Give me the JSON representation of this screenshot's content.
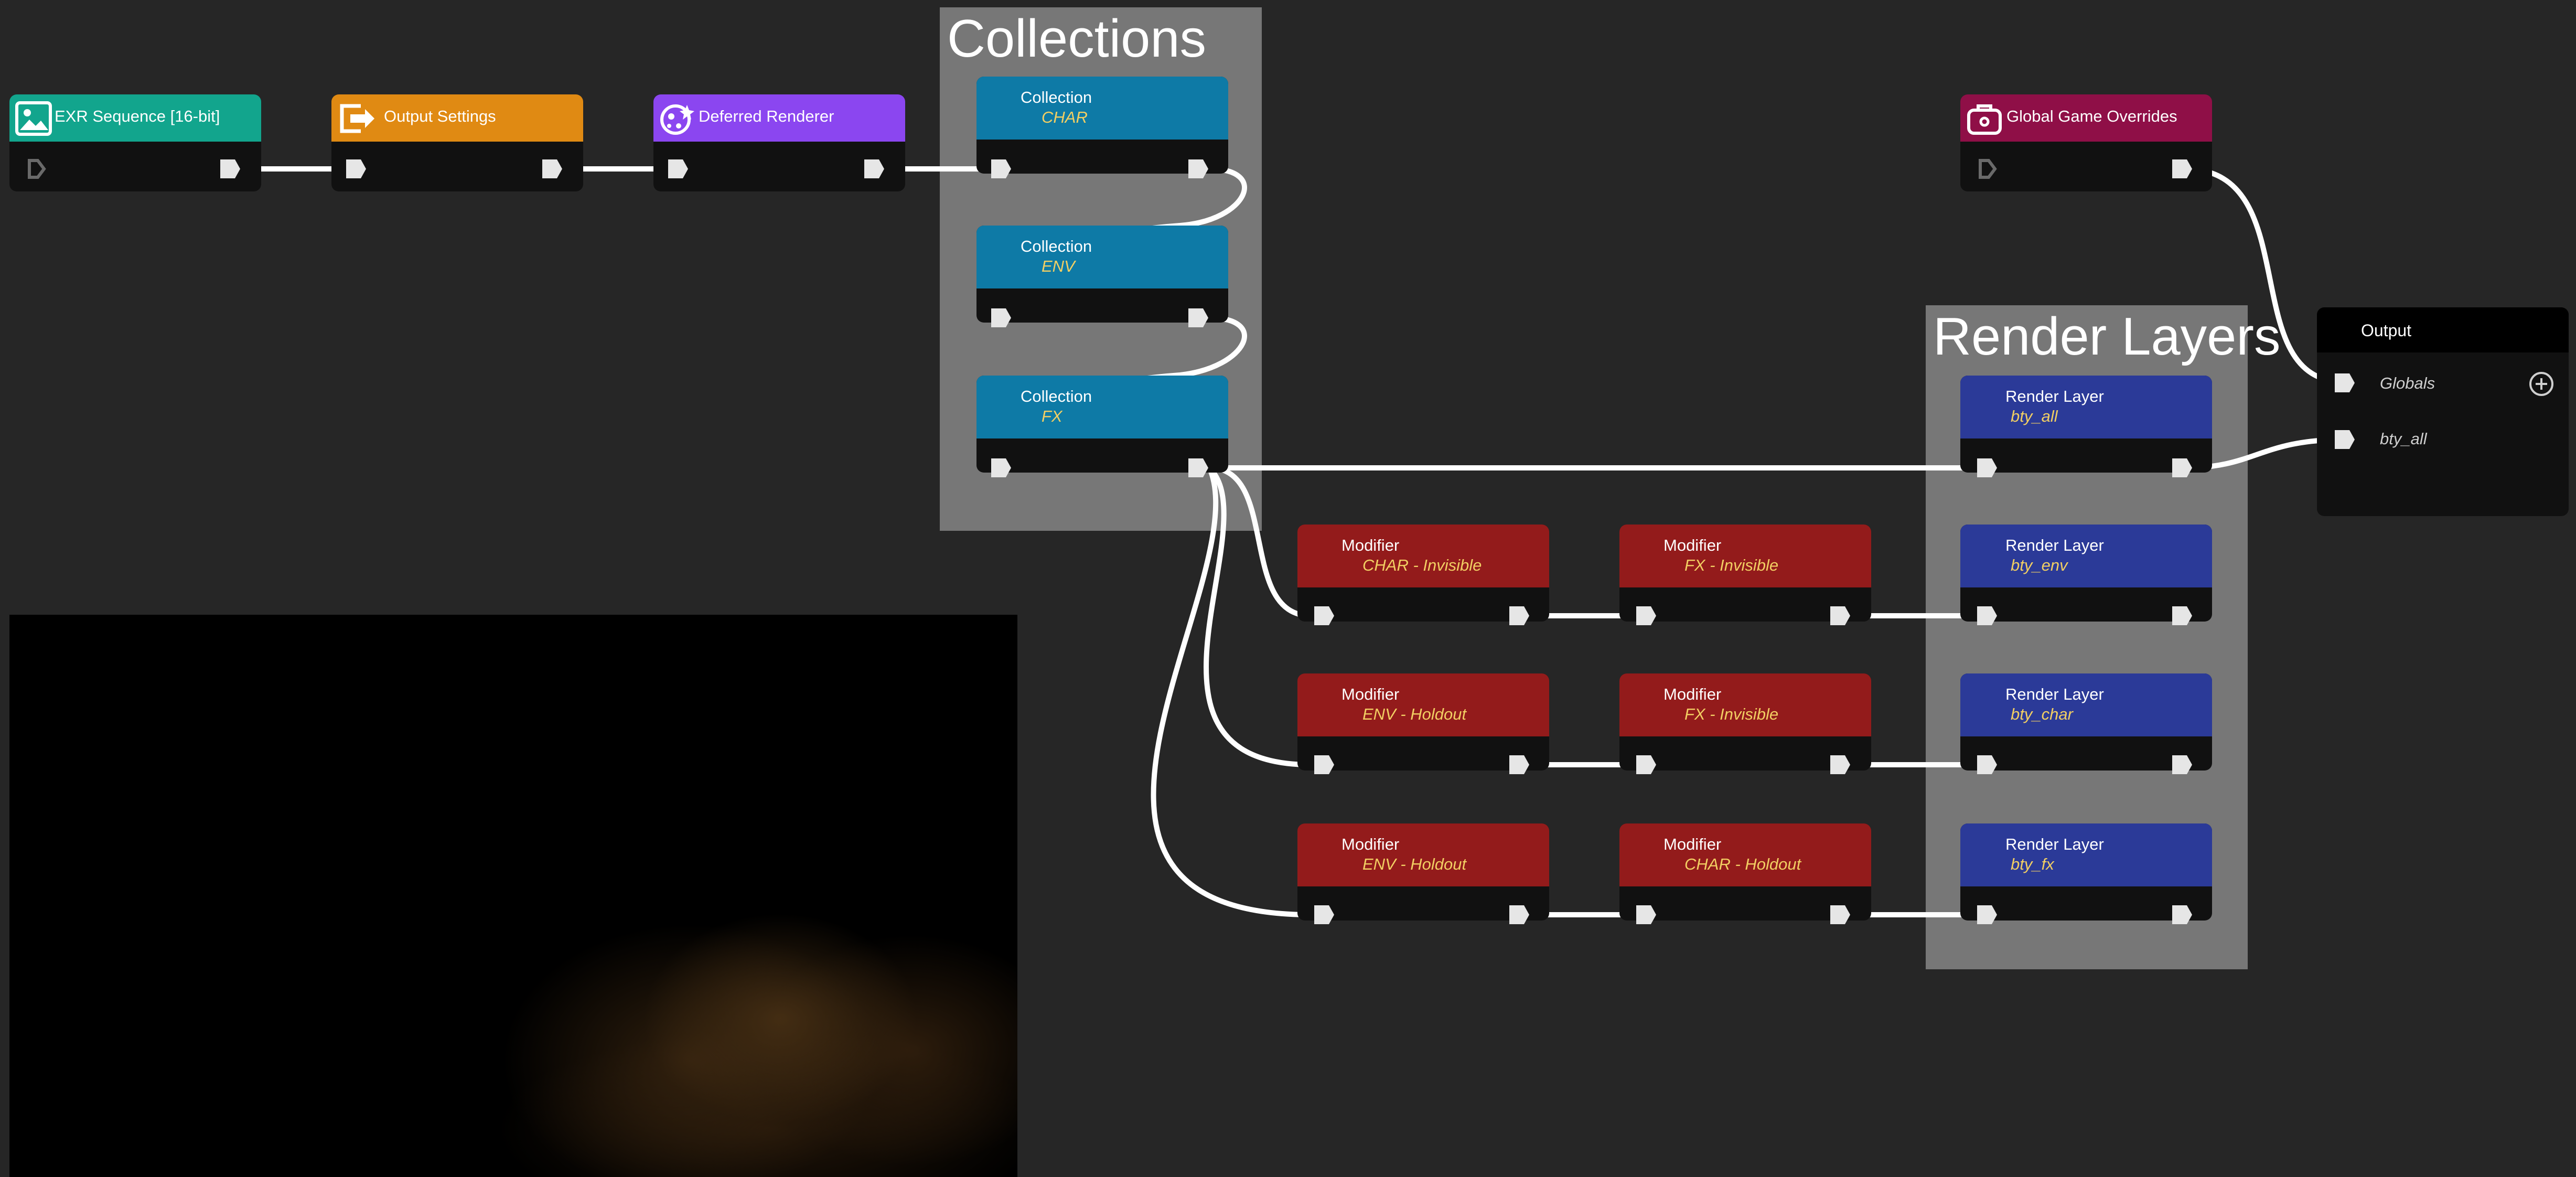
{
  "backdrops": {
    "collections_title": "Collections",
    "render_layers_title": "Render Layers"
  },
  "nodes": {
    "exr": {
      "label": "EXR Sequence [16-bit]",
      "color": "#12a58d",
      "icon": "image-icon"
    },
    "output_settings": {
      "label": "Output Settings",
      "color": "#e08a13",
      "icon": "export-icon"
    },
    "deferred": {
      "label": "Deferred Renderer",
      "color": "#8b46f0",
      "icon": "render-icon"
    },
    "global_overrides": {
      "label": "Global Game Overrides",
      "color": "#8f0f47",
      "icon": "controller-icon"
    },
    "collections": [
      {
        "label": "Collection",
        "sub": "CHAR",
        "color": "#0e7aa6"
      },
      {
        "label": "Collection",
        "sub": "ENV",
        "color": "#0e7aa6"
      },
      {
        "label": "Collection",
        "sub": "FX",
        "color": "#0e7aa6"
      }
    ],
    "modifiers": [
      {
        "label": "Modifier",
        "sub": "CHAR - Invisible",
        "color": "#931b1b"
      },
      {
        "label": "Modifier",
        "sub": "FX - Invisible",
        "color": "#931b1b"
      },
      {
        "label": "Modifier",
        "sub": "ENV - Holdout",
        "color": "#931b1b"
      },
      {
        "label": "Modifier",
        "sub": "FX - Invisible",
        "color": "#931b1b"
      },
      {
        "label": "Modifier",
        "sub": "ENV - Holdout",
        "color": "#931b1b"
      },
      {
        "label": "Modifier",
        "sub": "CHAR - Holdout",
        "color": "#931b1b"
      }
    ],
    "render_layers": [
      {
        "label": "Render Layer",
        "sub": "bty_all",
        "color": "#2b3a98"
      },
      {
        "label": "Render Layer",
        "sub": "bty_env",
        "color": "#2b3a98"
      },
      {
        "label": "Render Layer",
        "sub": "bty_char",
        "color": "#2b3a98"
      },
      {
        "label": "Render Layer",
        "sub": "bty_fx",
        "color": "#2b3a98"
      }
    ],
    "output": {
      "label": "Output",
      "inputs": [
        "Globals",
        "bty_all"
      ],
      "add_icon": "plus-circle-icon"
    }
  },
  "viewer": {
    "content": "preview-viewport"
  }
}
